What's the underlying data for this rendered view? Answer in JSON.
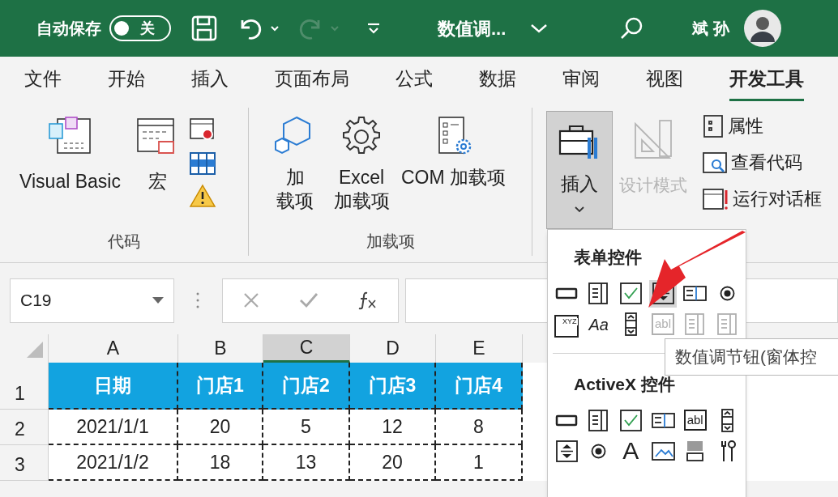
{
  "title_bar": {
    "autosave_label": "自动保存",
    "autosave_toggle": {
      "label": "关",
      "on": false
    },
    "redo_disabled": true,
    "doc_title": "数值调...",
    "user_name": "斌 孙"
  },
  "tabs": [
    {
      "label": "文件",
      "selected": false
    },
    {
      "label": "开始",
      "selected": false
    },
    {
      "label": "插入",
      "selected": false
    },
    {
      "label": "页面布局",
      "selected": false
    },
    {
      "label": "公式",
      "selected": false
    },
    {
      "label": "数据",
      "selected": false
    },
    {
      "label": "审阅",
      "selected": false
    },
    {
      "label": "视图",
      "selected": false
    },
    {
      "label": "开发工具",
      "selected": true
    }
  ],
  "ribbon": {
    "code_group": {
      "label": "代码",
      "visual_basic": "Visual Basic",
      "macros": "宏"
    },
    "addins_group": {
      "label": "加载项",
      "addins": [
        "加",
        "载项"
      ],
      "excel_addins": [
        "Excel",
        "加载项"
      ],
      "com_addins": "COM 加载项"
    },
    "controls_group": {
      "insert": {
        "label": "插入",
        "expanded": true
      },
      "design_mode": {
        "label": "设计模式",
        "disabled": true
      },
      "properties": "属性",
      "view_code": "查看代码",
      "run_dialog": "运行对话框"
    }
  },
  "formula_bar": {
    "name_box": "C19"
  },
  "sheet": {
    "columns": [
      {
        "label": "A",
        "selected": false
      },
      {
        "label": "B",
        "selected": false
      },
      {
        "label": "C",
        "selected": true
      },
      {
        "label": "D",
        "selected": false
      },
      {
        "label": "E",
        "selected": false
      }
    ],
    "rows": [
      {
        "number": "1",
        "kind": "header",
        "cells": [
          "日期",
          "门店1",
          "门店2",
          "门店3",
          "门店4"
        ]
      },
      {
        "number": "2",
        "kind": "data",
        "cells": [
          "2021/1/1",
          "20",
          "5",
          "12",
          "8"
        ]
      },
      {
        "number": "3",
        "kind": "data",
        "cells": [
          "2021/1/2",
          "18",
          "13",
          "20",
          "1"
        ]
      }
    ]
  },
  "insert_menu": {
    "sections": [
      {
        "title": "表单控件",
        "items": [
          {
            "kind": "button",
            "disabled": false,
            "selected": false
          },
          {
            "kind": "combo",
            "disabled": false,
            "selected": false
          },
          {
            "kind": "checkbox",
            "disabled": false,
            "selected": false
          },
          {
            "kind": "spinner",
            "disabled": false,
            "selected": true
          },
          {
            "kind": "listbox",
            "disabled": false,
            "selected": false
          },
          {
            "kind": "radio",
            "disabled": false,
            "selected": false
          },
          {
            "kind": "groupbox",
            "glyph": "XYZ",
            "disabled": false,
            "selected": false
          },
          {
            "kind": "label",
            "glyph": "Aa",
            "disabled": false,
            "selected": false
          },
          {
            "kind": "scrollbar",
            "disabled": false,
            "selected": false
          },
          {
            "kind": "textbox",
            "glyph": "abl",
            "disabled": true,
            "selected": false
          },
          {
            "kind": "combo",
            "disabled": true,
            "selected": false
          },
          {
            "kind": "combo",
            "disabled": true,
            "selected": false
          }
        ]
      },
      {
        "title": "ActiveX 控件",
        "items": [
          {
            "kind": "button",
            "disabled": false,
            "selected": false
          },
          {
            "kind": "combo",
            "disabled": false,
            "selected": false
          },
          {
            "kind": "checkbox",
            "disabled": false,
            "selected": false
          },
          {
            "kind": "listbox",
            "disabled": false,
            "selected": false
          },
          {
            "kind": "textbox",
            "glyph": "abl",
            "disabled": false,
            "selected": false
          },
          {
            "kind": "scrollbar",
            "disabled": false,
            "selected": false
          },
          {
            "kind": "spinner",
            "disabled": false,
            "selected": false
          },
          {
            "kind": "radio",
            "disabled": false,
            "selected": false
          },
          {
            "kind": "biglabel",
            "glyph": "A",
            "disabled": false,
            "selected": false
          },
          {
            "kind": "image",
            "disabled": false,
            "selected": false
          },
          {
            "kind": "toggle",
            "disabled": false,
            "selected": false
          },
          {
            "kind": "tools",
            "disabled": false,
            "selected": false
          }
        ]
      }
    ]
  },
  "tooltip": "数值调节钮(窗体控"
}
